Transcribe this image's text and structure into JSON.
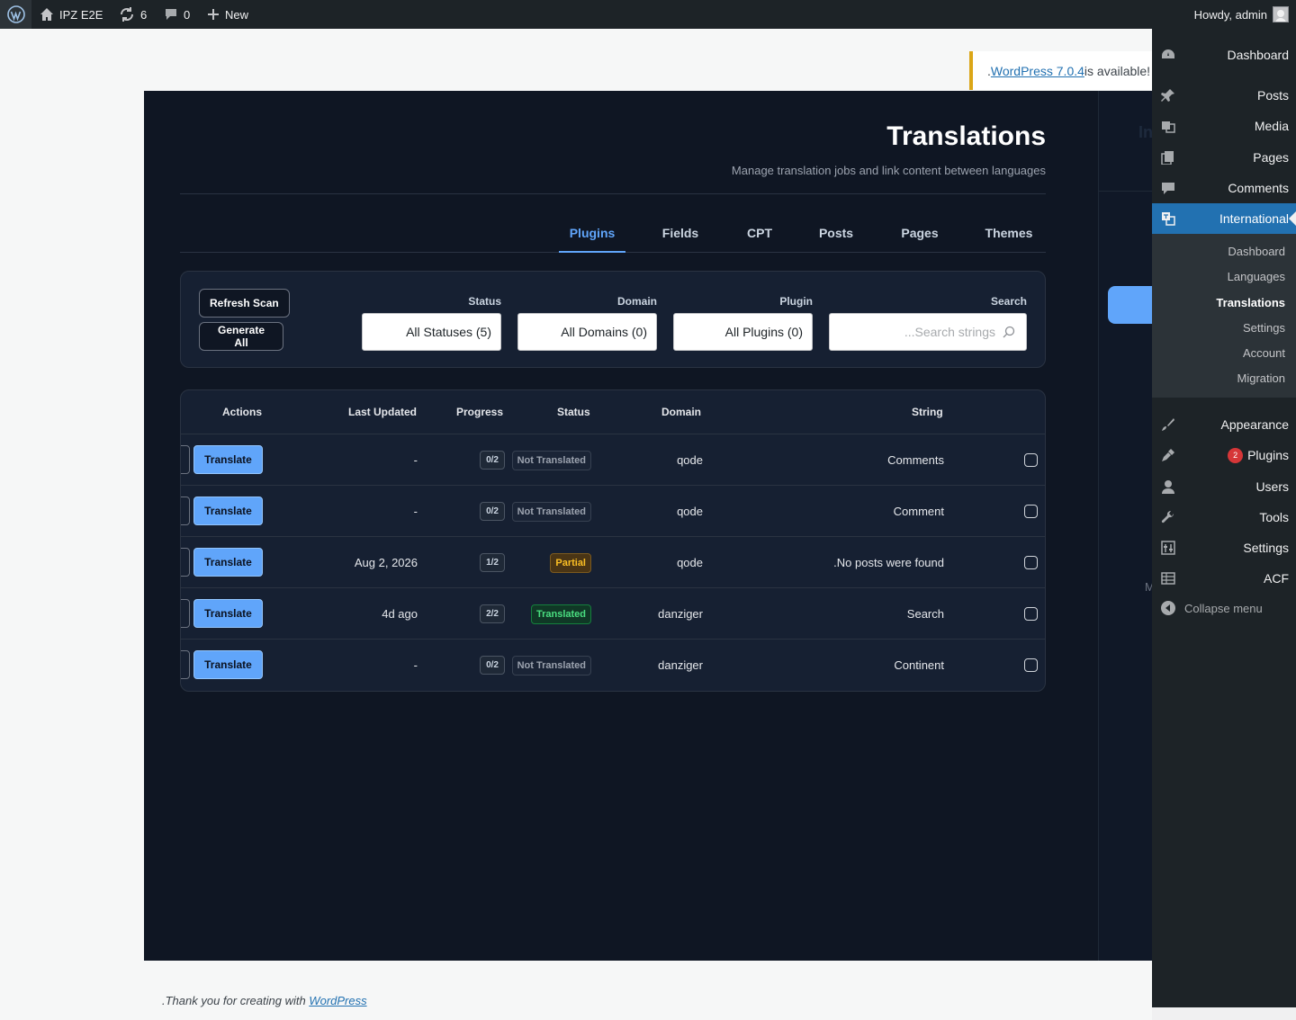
{
  "admin_bar": {
    "site_name": "IPZ E2E",
    "updates_count": "6",
    "comments_count": "0",
    "new_label": "New",
    "howdy": "Howdy, admin"
  },
  "update_nag": {
    "link_text": "WordPress 7.0.4",
    "suffix": " is available!",
    "prefix": "."
  },
  "header": {
    "title": "Translations",
    "subtitle": "Manage translation jobs and link content between languages"
  },
  "side_panel": {
    "ghost_text": "In",
    "ghost_m": "M"
  },
  "tabs": [
    {
      "label": "Plugins",
      "active": true
    },
    {
      "label": "Fields",
      "active": false
    },
    {
      "label": "CPT",
      "active": false
    },
    {
      "label": "Posts",
      "active": false
    },
    {
      "label": "Pages",
      "active": false
    },
    {
      "label": "Themes",
      "active": false
    }
  ],
  "filters": {
    "refresh_label": "Refresh Scan",
    "generate_label": "Generate All",
    "status_label": "Status",
    "status_value": "All Statuses (5)",
    "domain_label": "Domain",
    "domain_value": "All Domains (0)",
    "plugin_label": "Plugin",
    "plugin_value": "All Plugins (0)",
    "search_label": "Search",
    "search_placeholder": "...Search strings"
  },
  "table": {
    "headers": {
      "actions": "Actions",
      "last_updated": "Last Updated",
      "progress": "Progress",
      "status": "Status",
      "domain": "Domain",
      "string": "String"
    },
    "translate_label": "Translate",
    "rows": [
      {
        "string": "Comments",
        "domain": "qode",
        "status": "Not Translated",
        "tone": "none",
        "progress": "0/2",
        "updated": "-"
      },
      {
        "string": "Comment",
        "domain": "qode",
        "status": "Not Translated",
        "tone": "none",
        "progress": "0/2",
        "updated": "-"
      },
      {
        "string": ".No posts were found",
        "domain": "qode",
        "status": "Partial",
        "tone": "partial",
        "progress": "1/2",
        "updated": "Aug 2, 2026"
      },
      {
        "string": "Search",
        "domain": "danziger",
        "status": "Translated",
        "tone": "translated",
        "progress": "2/2",
        "updated": "4d ago"
      },
      {
        "string": "Continent",
        "domain": "danziger",
        "status": "Not Translated",
        "tone": "none",
        "progress": "0/2",
        "updated": "-"
      }
    ]
  },
  "footer": {
    "prefix": ".Thank you for creating with ",
    "link": "WordPress"
  },
  "admin_menu": {
    "items": [
      {
        "label": "Dashboard",
        "icon": "dashboard-icon"
      },
      {
        "label": "Posts",
        "icon": "pin-icon"
      },
      {
        "label": "Media",
        "icon": "media-icon"
      },
      {
        "label": "Pages",
        "icon": "pages-icon"
      },
      {
        "label": "Comments",
        "icon": "comment-icon"
      },
      {
        "label": "International",
        "icon": "translation-icon"
      },
      {
        "label": "Appearance",
        "icon": "brush-icon"
      },
      {
        "label": "Plugins",
        "icon": "plugin-icon",
        "badge": "2"
      },
      {
        "label": "Users",
        "icon": "user-icon"
      },
      {
        "label": "Tools",
        "icon": "wrench-icon"
      },
      {
        "label": "Settings",
        "icon": "sliders-icon"
      },
      {
        "label": "ACF",
        "icon": "grid-icon"
      }
    ],
    "submenu": [
      "Dashboard",
      "Languages",
      "Translations",
      "Settings",
      "Account",
      "Migration"
    ],
    "collapse_label": "Collapse menu"
  }
}
